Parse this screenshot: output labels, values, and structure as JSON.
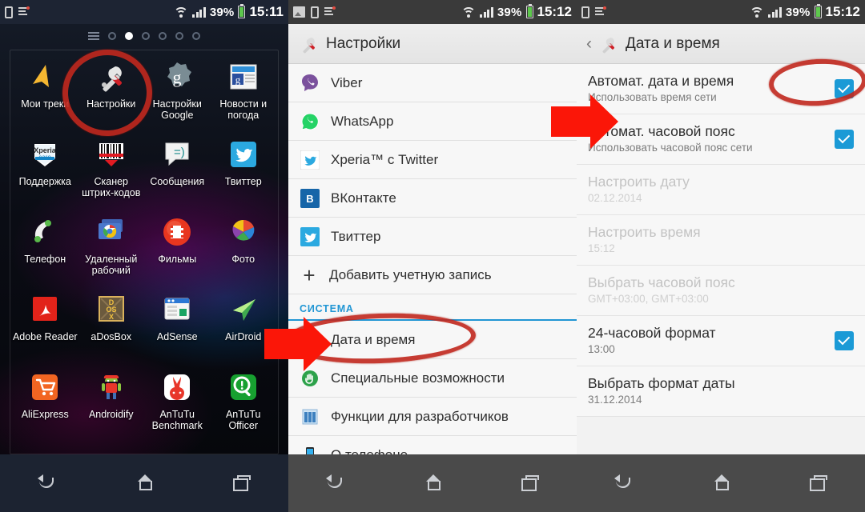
{
  "left_screen": {
    "statusbar": {
      "icons": [
        "phone-icon",
        "list-notification-icon"
      ],
      "battery_text": "39%",
      "time": "15:11",
      "wifi": "wifi-icon",
      "signal": "signal-icon"
    },
    "page_indicator": {
      "total": 6,
      "active_index": 1,
      "menu": "hamburger-icon"
    },
    "apps": [
      {
        "label": "Мои треки",
        "icon": "navigation-arrow-icon"
      },
      {
        "label": "Настройки",
        "icon": "tools-icon"
      },
      {
        "label": "Настройки Google",
        "icon": "google-gear-icon"
      },
      {
        "label": "Новости и погода",
        "icon": "news-icon"
      },
      {
        "label": "Поддержка",
        "icon": "xperia-care-icon"
      },
      {
        "label": "Сканер штрих-кодов",
        "icon": "barcode-icon"
      },
      {
        "label": "Сообщения",
        "icon": "messaging-icon"
      },
      {
        "label": "Твиттер",
        "icon": "twitter-icon"
      },
      {
        "label": "Телефон",
        "icon": "phone-handset-icon"
      },
      {
        "label": "Удаленный рабочий",
        "icon": "chrome-remote-desktop-icon"
      },
      {
        "label": "Фильмы",
        "icon": "movies-icon"
      },
      {
        "label": "Фото",
        "icon": "photos-pinwheel-icon"
      },
      {
        "label": "Adobe Reader",
        "icon": "adobe-reader-icon"
      },
      {
        "label": "aDosBox",
        "icon": "dosbox-icon"
      },
      {
        "label": "AdSense",
        "icon": "adsense-icon"
      },
      {
        "label": "AirDroid",
        "icon": "airdroid-icon"
      },
      {
        "label": "AliExpress",
        "icon": "aliexpress-cart-icon"
      },
      {
        "label": "Androidify",
        "icon": "androidify-icon"
      },
      {
        "label": "AnTuTu Benchmark",
        "icon": "antutu-rabbit-icon"
      },
      {
        "label": "AnTuTu Officer",
        "icon": "antutu-officer-icon"
      }
    ],
    "navbar": [
      "back-icon",
      "home-icon",
      "recents-icon"
    ],
    "annotation": {
      "type": "ellipse",
      "color": "#c1281e",
      "target": "Настройки"
    }
  },
  "middle_screen": {
    "statusbar": {
      "icons": [
        "image-icon",
        "phone-icon",
        "list-notification-icon"
      ],
      "battery_text": "39%",
      "time": "15:12"
    },
    "header": {
      "title": "Настройки",
      "icon": "tools-icon"
    },
    "items": [
      {
        "label": "Viber",
        "icon": "viber-icon"
      },
      {
        "label": "WhatsApp",
        "icon": "whatsapp-icon"
      },
      {
        "label": "Xperia™ с Twitter",
        "icon": "twitter-white-icon"
      },
      {
        "label": "ВКонтакте",
        "icon": "vk-icon"
      },
      {
        "label": "Твиттер",
        "icon": "twitter-icon"
      },
      {
        "label": "Добавить учетную запись",
        "icon": "plus-icon"
      }
    ],
    "section_header": "СИСТЕМА",
    "system_items": [
      {
        "label": "Дата и время",
        "icon": "clock-icon"
      },
      {
        "label": "Специальные возможности",
        "icon": "accessibility-hand-icon"
      },
      {
        "label": "Функции для разработчиков",
        "icon": "developer-icon"
      },
      {
        "label": "О телефоне",
        "icon": "phone-about-icon"
      }
    ],
    "navbar": [
      "back-icon",
      "home-icon",
      "recents-icon"
    ],
    "annotations": {
      "ellipse_target": "Дата и время",
      "arrow": "red-arrow-right",
      "color": "#c1281e"
    }
  },
  "right_screen": {
    "statusbar": {
      "icons": [
        "phone-icon",
        "list-notification-icon"
      ],
      "battery_text": "39%",
      "time": "15:12"
    },
    "header": {
      "title": "Дата и время",
      "icon": "tools-icon",
      "back": "chevron-left-icon"
    },
    "rows": [
      {
        "title": "Автомат. дата и время",
        "subtitle": "Использовать время сети",
        "checkbox": true,
        "enabled": true
      },
      {
        "title": "Автомат. часовой пояс",
        "subtitle": "Использовать часовой пояс сети",
        "checkbox": true,
        "enabled": true
      },
      {
        "title": "Настроить дату",
        "subtitle": "02.12.2014",
        "checkbox": false,
        "enabled": false
      },
      {
        "title": "Настроить время",
        "subtitle": "15:12",
        "checkbox": false,
        "enabled": false
      },
      {
        "title": "Выбрать часовой пояс",
        "subtitle": "GMT+03:00, GMT+03:00",
        "checkbox": false,
        "enabled": false
      },
      {
        "title": "24-часовой формат",
        "subtitle": "13:00",
        "checkbox": true,
        "enabled": true
      },
      {
        "title": "Выбрать формат даты",
        "subtitle": "31.12.2014",
        "checkbox": false,
        "enabled": true
      }
    ],
    "navbar": [
      "back-icon",
      "home-icon",
      "recents-icon"
    ],
    "annotations": {
      "ellipse_target": "Автомат. дата и время checkbox",
      "arrow": "red-arrow-right",
      "color": "#c1281e"
    }
  }
}
